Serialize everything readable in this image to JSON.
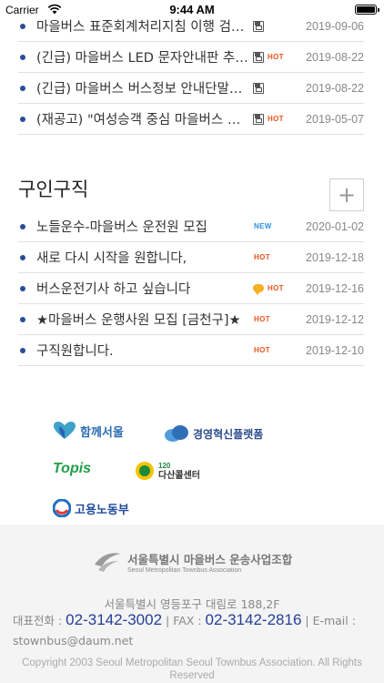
{
  "status_bar": {
    "carrier": "Carrier",
    "time": "9:44 AM"
  },
  "notices": [
    {
      "title": "마을버스 표준회계처리지침 이행 검…",
      "file": true,
      "hot": false,
      "date": "2019-09-06"
    },
    {
      "title": "(긴급) 마을버스 LED 문자안내판 추…",
      "file": true,
      "hot": true,
      "date": "2019-08-22"
    },
    {
      "title": "(긴급) 마을버스 버스정보 안내단말…",
      "file": true,
      "hot": false,
      "date": "2019-08-22"
    },
    {
      "title": "(재공고) \"여성승객 중심 마을버스 …",
      "file": true,
      "hot": true,
      "date": "2019-05-07"
    }
  ],
  "jobs": {
    "section_title": "구인구직",
    "add_label": "+",
    "items": [
      {
        "title": "노들운수-마을버스 운전원 모집",
        "badge": "NEW",
        "talk": false,
        "date": "2020-01-02"
      },
      {
        "title": "새로 다시 시작을 원합니다,",
        "badge": "HOT",
        "talk": false,
        "date": "2019-12-18"
      },
      {
        "title": "버스운전기사 하고 싶습니다",
        "badge": "HOT",
        "talk": true,
        "date": "2019-12-16"
      },
      {
        "title": "★마을버스 운행사원 모집 [금천구]★",
        "badge": "HOT",
        "talk": false,
        "date": "2019-12-12"
      },
      {
        "title": "구직원합니다.",
        "badge": "HOT",
        "talk": false,
        "date": "2019-12-10"
      }
    ]
  },
  "partners": {
    "seoul": "함께서울",
    "mgmt": "경영혁신플랫폼",
    "topis": "Topis",
    "dasan": "다산콜센터",
    "dasan_num": "120",
    "moel": "고용노동부"
  },
  "footer": {
    "assoc_ko": "서울특별시 마을버스 운송사업조합",
    "assoc_en": "Seoul Metropolitan Townbus Association",
    "address": "서울특별시 영등포구 대림로 188,2F",
    "tel_label": "대표전화 : ",
    "tel": "02-3142-3002",
    "fax_label": " | FAX : ",
    "fax": "02-3142-2816",
    "email_label": " | E-mail : ",
    "email": "stownbus@daum.net",
    "copyright": "Copyright 2003 Seoul Metropolitan Seoul Townbus Association. All Rights Reserved"
  },
  "colors": {
    "accent": "#233f97",
    "hot": "#e8551e",
    "new": "#2f8fe0"
  }
}
